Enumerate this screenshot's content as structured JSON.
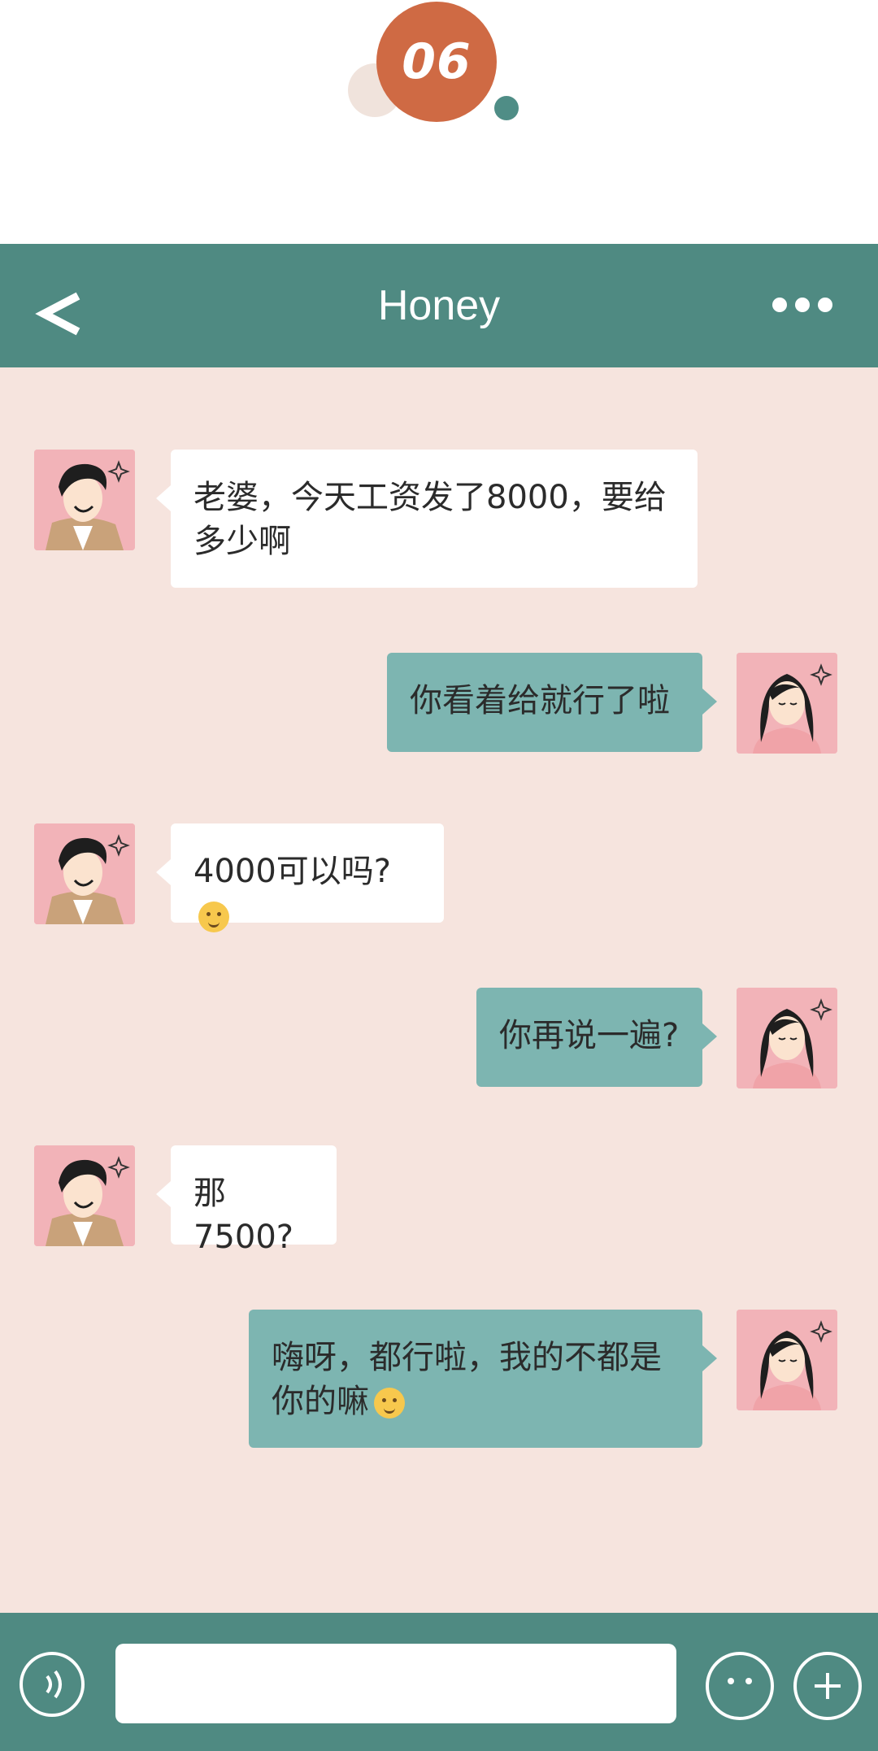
{
  "badge": {
    "number": "06"
  },
  "header": {
    "title": "Honey",
    "back_icon": "chevron-left-icon",
    "more_icon": "more-dots-icon"
  },
  "messages": [
    {
      "side": "left",
      "sender": "boyfriend",
      "text": "老婆，今天工资发了8000，要给多少啊"
    },
    {
      "side": "right",
      "sender": "girlfriend",
      "text": "你看着给就行了啦"
    },
    {
      "side": "left",
      "sender": "boyfriend",
      "text": "4000可以吗?",
      "emoji": "smile-emoji"
    },
    {
      "side": "right",
      "sender": "girlfriend",
      "text": "你再说一遍?"
    },
    {
      "side": "left",
      "sender": "boyfriend",
      "text": "那7500?"
    },
    {
      "side": "right",
      "sender": "girlfriend",
      "text": "嗨呀，都行啦，我的不都是你的嘛",
      "emoji": "flushed-emoji"
    }
  ],
  "input": {
    "value": "",
    "placeholder": ""
  },
  "colors": {
    "header": "#4f8a82",
    "chat_bg": "#f6e4de",
    "right_bubble": "#7db5b1",
    "badge": "#cf6a44"
  }
}
